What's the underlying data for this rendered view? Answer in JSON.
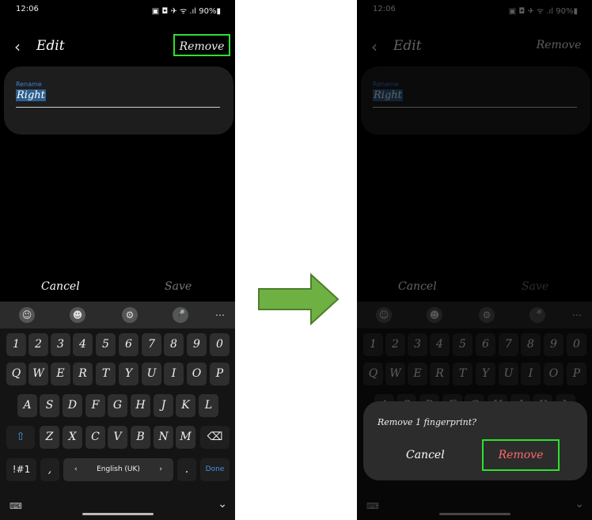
{
  "status": {
    "time": "12:06",
    "icons": "▣ ◘ ✈ ᯤ .ıl 90%▮"
  },
  "header": {
    "back_glyph": "‹",
    "title": "Edit",
    "remove_label": "Remove"
  },
  "rename": {
    "label": "Rename",
    "value": "Right"
  },
  "actions": {
    "cancel": "Cancel",
    "save": "Save"
  },
  "keyboard": {
    "toolbar": [
      "☺",
      "☻",
      "⚙",
      "🎤",
      "⋯"
    ],
    "row1": [
      "1",
      "2",
      "3",
      "4",
      "5",
      "6",
      "7",
      "8",
      "9",
      "0"
    ],
    "row2": [
      "Q",
      "W",
      "E",
      "R",
      "T",
      "Y",
      "U",
      "I",
      "O",
      "P"
    ],
    "row3": [
      "A",
      "S",
      "D",
      "F",
      "G",
      "H",
      "J",
      "K",
      "L"
    ],
    "row4": [
      "⇧",
      "Z",
      "X",
      "C",
      "V",
      "B",
      "N",
      "M",
      "⌫"
    ],
    "row5": [
      "!#1",
      ",",
      "‹",
      "English (UK)",
      "›",
      ".",
      "Done"
    ]
  },
  "navbar": {
    "keyboard_glyph": "⌨",
    "hide_glyph": "⌄"
  },
  "dialog": {
    "message": "Remove 1 fingerprint?",
    "cancel": "Cancel",
    "remove": "Remove"
  },
  "colors": {
    "highlight": "#2ee02e",
    "arrow": "#6fb043",
    "danger": "#ff6b6b",
    "link": "#4a90e2"
  }
}
